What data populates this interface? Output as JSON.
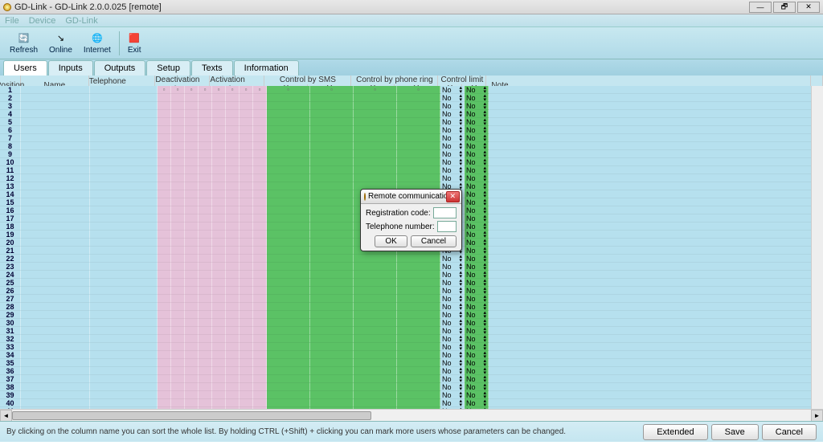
{
  "window": {
    "title": "GD-Link - GD-Link 2.0.0.025 [remote]",
    "min": "—",
    "restore": "🗗",
    "close": "✕"
  },
  "menu": {
    "file": "File",
    "device": "Device",
    "gdlink": "GD-Link"
  },
  "toolbar": {
    "refresh": "Refresh",
    "online": "Online",
    "internet": "Internet",
    "exit": "Exit"
  },
  "tabs": {
    "users": "Users",
    "inputs": "Inputs",
    "outputs": "Outputs",
    "setup": "Setup",
    "texts": "Texts",
    "information": "Information",
    "active": "users"
  },
  "grid": {
    "headers": {
      "position": "Position",
      "name": "Name",
      "telephone": "Telephone number",
      "deact": "Deactivation report",
      "act": "Activation report",
      "sms": "Control by SMS",
      "ring": "Control by phone ring",
      "limit": "Control limit",
      "note": "Note",
      "a": "A",
      "b": "B",
      "c": "C",
      "d": "D",
      "x": "X",
      "y": "Y"
    },
    "row_count": 41,
    "limit_value": "No"
  },
  "dialog": {
    "title": "Remote communication sett...",
    "reg_label": "Registration code:",
    "tel_label": "Telephone number:",
    "reg_value": "",
    "tel_value": "",
    "ok": "OK",
    "cancel": "Cancel"
  },
  "status": {
    "hint": "By clicking on the column name you can sort the whole list. By holding CTRL (+Shift) + clicking you can mark more users whose parameters can be changed.",
    "extended": "Extended",
    "save": "Save",
    "cancel": "Cancel"
  }
}
